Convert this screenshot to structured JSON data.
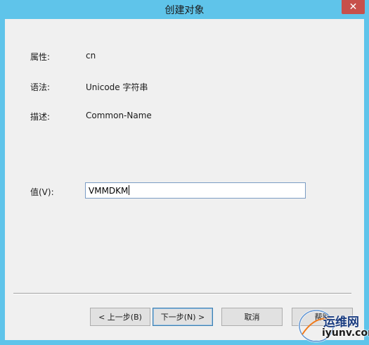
{
  "window": {
    "title": "创建对象",
    "close_glyph": "✕"
  },
  "form": {
    "attribute_label": "属性:",
    "attribute_value": "cn",
    "syntax_label": "语法:",
    "syntax_value": "Unicode 字符串",
    "description_label": "描述:",
    "description_value": "Common-Name",
    "value_label": "值(V):",
    "value_input": "VMMDKM"
  },
  "buttons": {
    "back": "< 上一步(B)",
    "next": "下一步(N) >",
    "cancel": "取消",
    "help": "帮助"
  },
  "watermark": {
    "line1": "运维网",
    "line2": "iyunv.com"
  }
}
